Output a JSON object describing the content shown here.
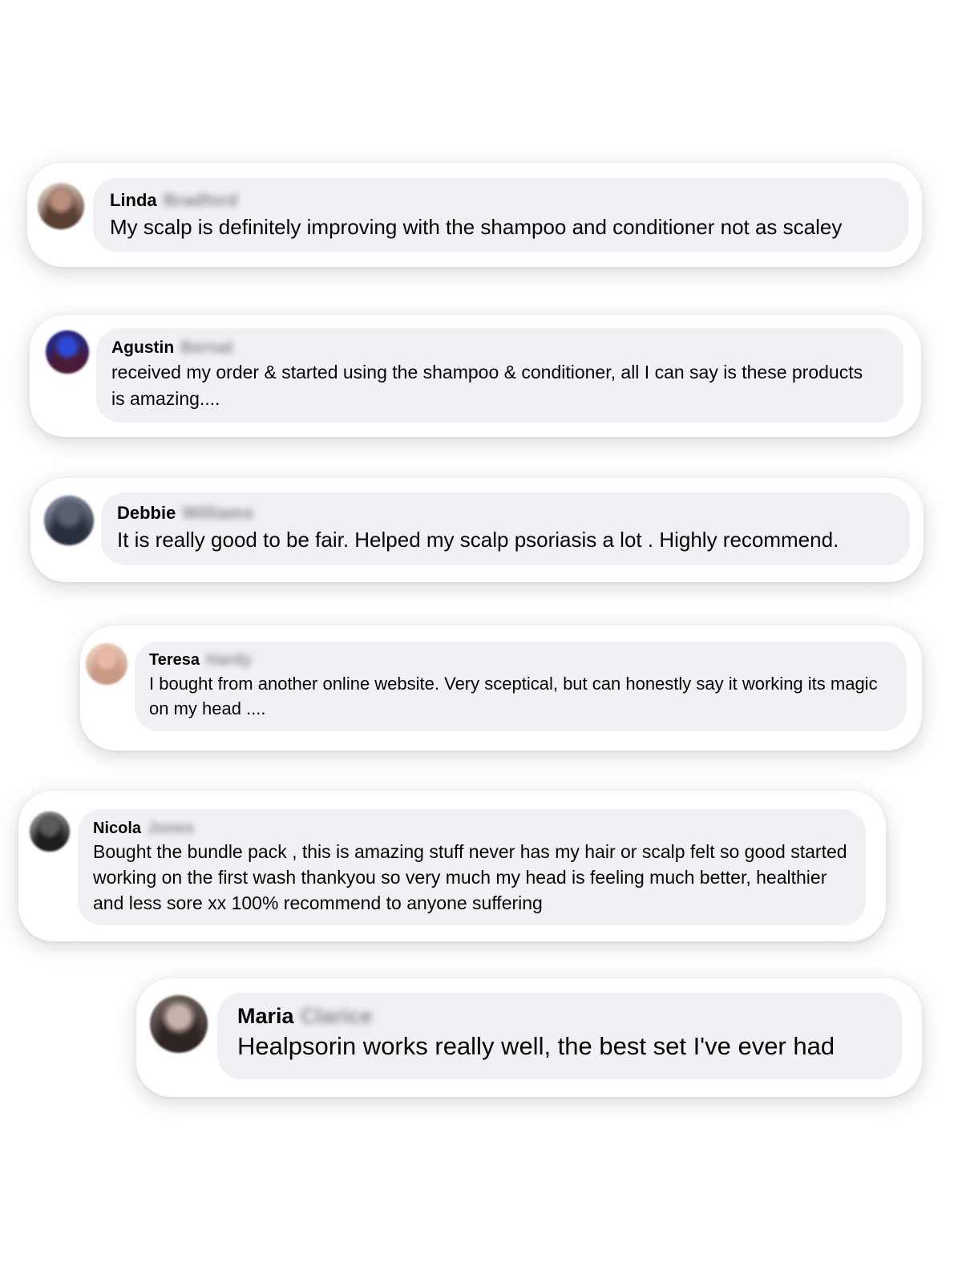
{
  "comments": [
    {
      "first_name": "Linda",
      "last_name": "Bradford",
      "text": "My scalp is definitely improving with the shampoo and conditioner not as scaley",
      "avatar_colors": [
        "#e8d6cc",
        "#5a3f33",
        "#b98e7a"
      ]
    },
    {
      "first_name": "Agustin",
      "last_name": "Bernal",
      "text": "received my order & started using the shampoo & conditioner, all I can say is these products is amazing....",
      "avatar_colors": [
        "#1b2a9c",
        "#4b1b38",
        "#2b49d6"
      ]
    },
    {
      "first_name": "Debbie",
      "last_name": "Williams",
      "text": "It is really good to be fair. Helped my scalp psoriasis a lot . Highly recommend.",
      "avatar_colors": [
        "#8e95a8",
        "#2a2f3d",
        "#5a6072"
      ]
    },
    {
      "first_name": "Teresa",
      "last_name": "Hardy",
      "text": "I bought from another online website. Very sceptical, but can honestly say it working its magic on my head ....",
      "avatar_colors": [
        "#f1d3c6",
        "#c99a86",
        "#e8b9a6"
      ]
    },
    {
      "first_name": "Nicola",
      "last_name": "Jones",
      "text": "Bought the bundle pack , this is amazing stuff never has my hair or scalp felt so good started working on the first wash thankyou so very much my head is feeling much better, healthier and less sore xx 100% recommend to anyone suffering",
      "avatar_colors": [
        "#9a9a9a",
        "#1e1e1e",
        "#5a5a5a"
      ]
    },
    {
      "first_name": "Maria",
      "last_name": "Clarice",
      "text": "Healpsorin works really well, the best set I've ever had",
      "avatar_colors": [
        "#7a6a66",
        "#2e2523",
        "#c7b1a8"
      ]
    }
  ]
}
